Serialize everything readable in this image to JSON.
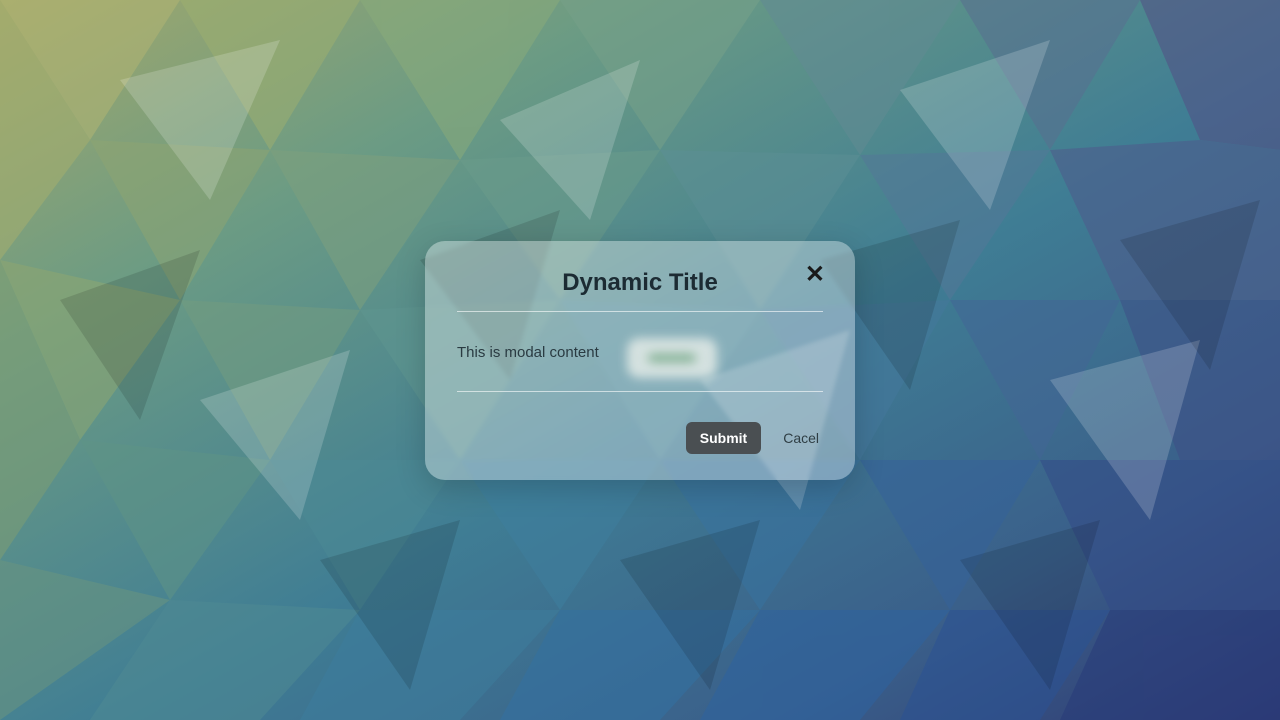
{
  "modal": {
    "title": "Dynamic Title",
    "content": "This is modal content",
    "close_label": "✕",
    "submit_label": "Submit",
    "cancel_label": "Cacel"
  }
}
